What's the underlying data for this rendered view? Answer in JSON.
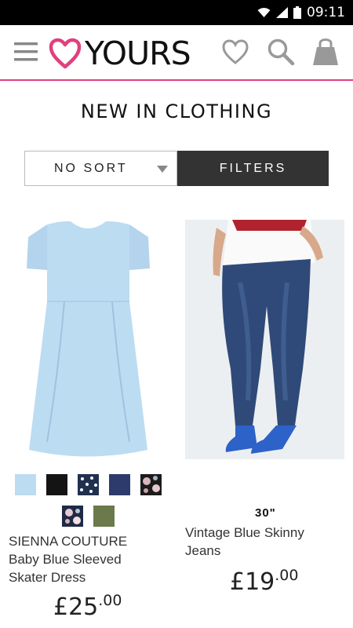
{
  "status_bar": {
    "time": "09:11",
    "icons": [
      "wifi-icon",
      "signal-icon",
      "battery-icon"
    ]
  },
  "header": {
    "brand": "YOURS",
    "accent_color": "#e0407f",
    "icons": [
      "menu-icon",
      "heart-logo-icon",
      "wishlist-heart-icon",
      "search-icon",
      "shopping-bag-icon"
    ]
  },
  "page": {
    "title": "NEW IN CLOTHING"
  },
  "toolbar": {
    "sort_label": "NO SORT",
    "filters_label": "FILTERS"
  },
  "products": [
    {
      "name_line1": "SIENNA COUTURE",
      "name_line2": "Baby Blue Sleeved",
      "name_line3": "Skater Dress",
      "price_currency": "£25",
      "price_pence": ".00",
      "swatches": [
        "light-blue",
        "black",
        "navy-polka-dot",
        "navy",
        "black-floral",
        "navy-floral",
        "khaki"
      ]
    },
    {
      "badge": "30\"",
      "name_line1": "Vintage Blue Skinny",
      "name_line2": "Jeans",
      "price_currency": "£19",
      "price_pence": ".00"
    }
  ]
}
